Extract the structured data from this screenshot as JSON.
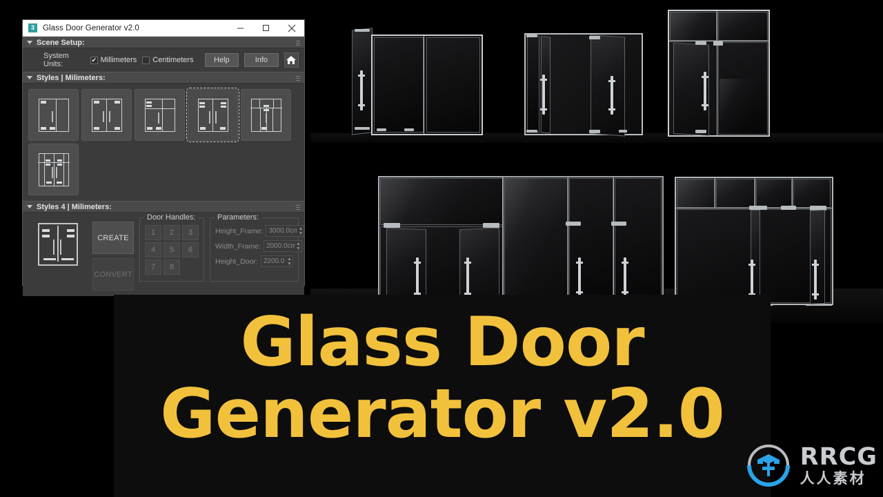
{
  "window": {
    "app_icon": "3",
    "title": "Glass Door Generator v2.0",
    "controls": {
      "minimize": "minimize-icon",
      "maximize": "maximize-icon",
      "close": "close-icon"
    }
  },
  "scene_setup": {
    "header": "Scene Setup:",
    "system_units_label": "System Units:",
    "units": [
      {
        "label": "Millimeters",
        "checked": true,
        "mark": "✔"
      },
      {
        "label": "Centimeters",
        "checked": false,
        "mark": ""
      }
    ],
    "help_button": "Help",
    "info_button": "Info",
    "home_button": "home-icon"
  },
  "styles": {
    "header": "Styles | Milimeters:",
    "items": [
      {
        "id": 1,
        "name": "style-1",
        "selected": false
      },
      {
        "id": 2,
        "name": "style-2",
        "selected": false
      },
      {
        "id": 3,
        "name": "style-3",
        "selected": false
      },
      {
        "id": 4,
        "name": "style-4",
        "selected": true
      },
      {
        "id": 5,
        "name": "style-5",
        "selected": false
      },
      {
        "id": 6,
        "name": "style-6",
        "selected": false
      }
    ]
  },
  "style_detail": {
    "header": "Styles 4 | Milimeters:",
    "create_button": "CREATE",
    "convert_button": "CONVERT",
    "door_handles": {
      "label": "Door Handles:",
      "buttons": [
        "1",
        "2",
        "3",
        "4",
        "5",
        "6",
        "7",
        "8"
      ]
    },
    "parameters": {
      "label": "Parameters:",
      "rows": [
        {
          "name": "Height_Frame:",
          "value": "3000.0cm"
        },
        {
          "name": "Width_Frame:",
          "value": "2000.0cm"
        },
        {
          "name": "Height_Door:",
          "value": "2200.0"
        }
      ]
    }
  },
  "overlay": {
    "title_line1": "Glass Door",
    "title_line2": "Generator v2.0",
    "title_color": "#f2c13c",
    "background": "#0d0d0d"
  },
  "watermark": {
    "logo": "rrcg-logo-icon",
    "brand": "RRCG",
    "brand_cn": "人人素材",
    "accent_color": "#2aa3e8"
  },
  "renders": {
    "caption": "glass door 3d previews",
    "items": [
      {
        "name": "render-double-door-open-left"
      },
      {
        "name": "render-double-door-open-both"
      },
      {
        "name": "render-door-with-transom"
      },
      {
        "name": "render-double-swing-doors"
      },
      {
        "name": "render-wide-glass-wall"
      },
      {
        "name": "render-wide-glass-wall-transom"
      }
    ]
  }
}
